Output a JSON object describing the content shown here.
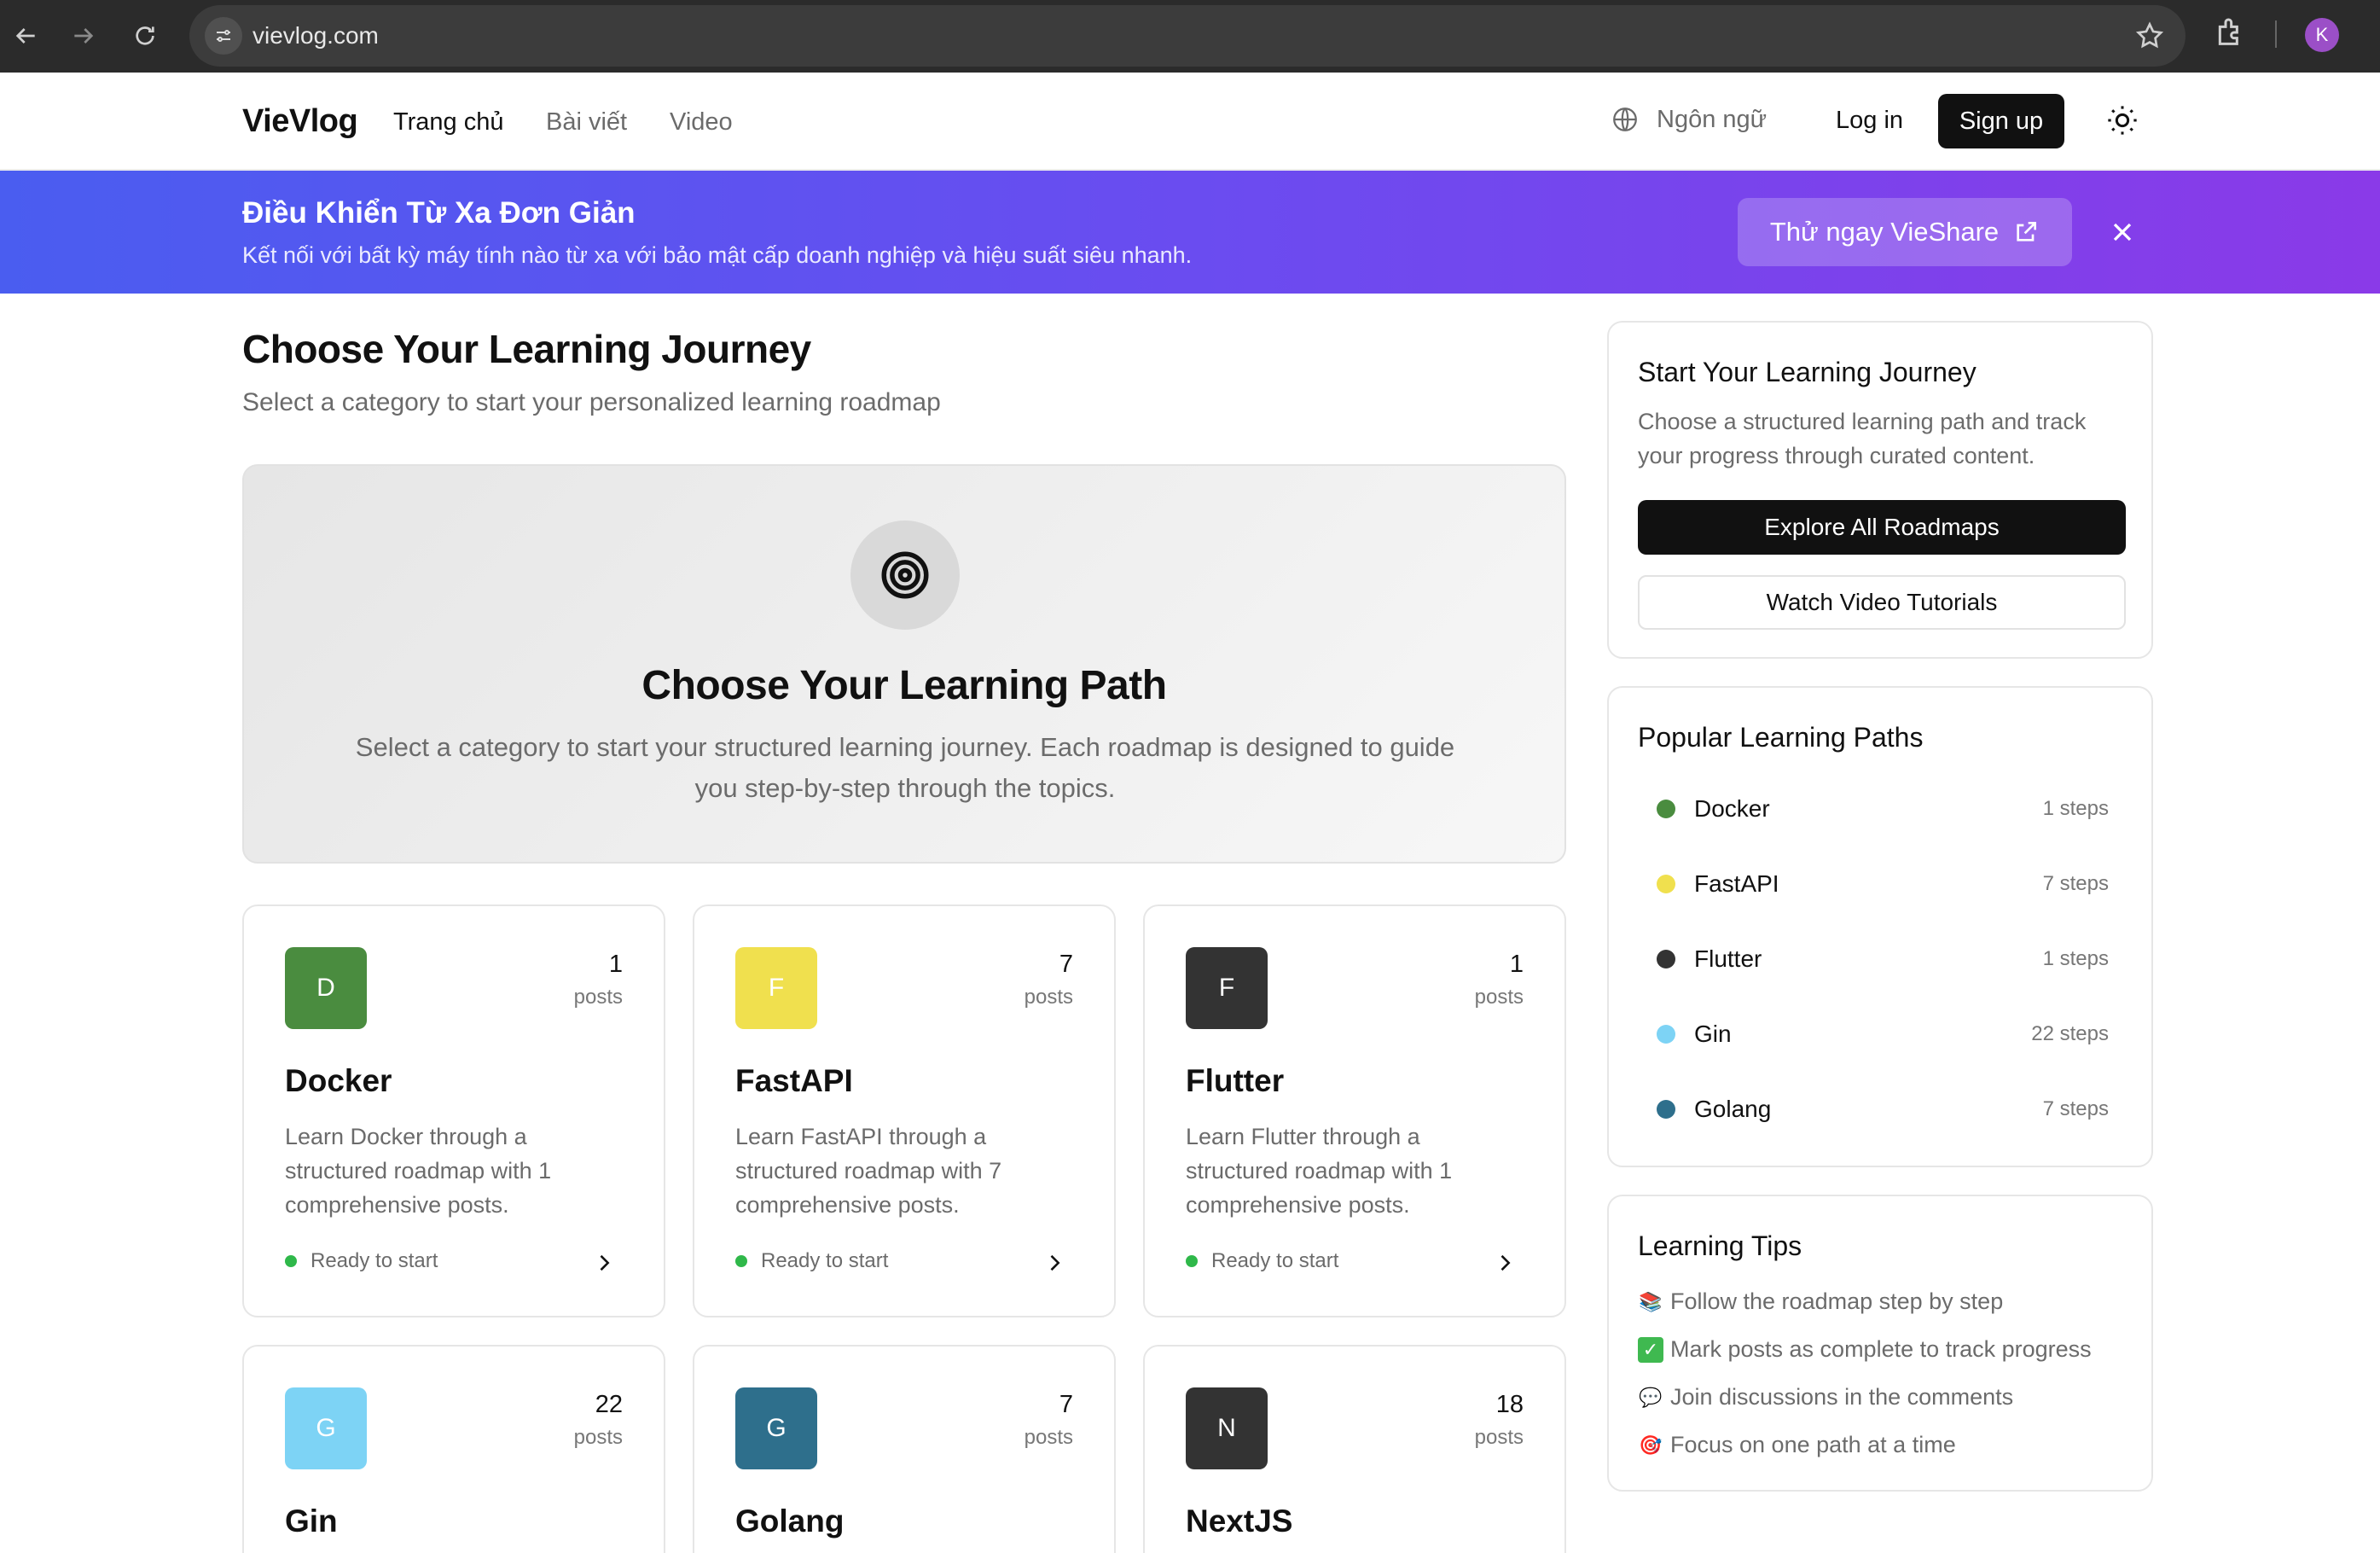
{
  "browser": {
    "url": "vievlog.com",
    "profile_initial": "K"
  },
  "header": {
    "logo": "VieVlog",
    "nav": [
      "Trang chủ",
      "Bài viết",
      "Video"
    ],
    "language_label": "Ngôn ngữ",
    "login_label": "Log in",
    "signup_label": "Sign up"
  },
  "banner": {
    "title": "Điều Khiển Từ Xa Đơn Giản",
    "subtitle": "Kết nối với bất kỳ máy tính nào từ xa với bảo mật cấp doanh nghiệp và hiệu suất siêu nhanh.",
    "cta_label": "Thử ngay VieShare"
  },
  "main": {
    "title": "Choose Your Learning Journey",
    "subtitle": "Select a category to start your personalized learning roadmap",
    "hero": {
      "title": "Choose Your Learning Path",
      "description": "Select a category to start your structured learning journey. Each roadmap is designed to guide you step-by-step through the topics."
    },
    "cards": [
      {
        "initial": "D",
        "color": "#4a8c3f",
        "count": "1",
        "count_label": "posts",
        "name": "Docker",
        "description": "Learn Docker through a structured roadmap with 1 comprehensive posts.",
        "status": "Ready to start"
      },
      {
        "initial": "F",
        "color": "#f0e04e",
        "count": "7",
        "count_label": "posts",
        "name": "FastAPI",
        "description": "Learn FastAPI through a structured roadmap with 7 comprehensive posts.",
        "status": "Ready to start"
      },
      {
        "initial": "F",
        "color": "#333333",
        "count": "1",
        "count_label": "posts",
        "name": "Flutter",
        "description": "Learn Flutter through a structured roadmap with 1 comprehensive posts.",
        "status": "Ready to start"
      },
      {
        "initial": "G",
        "color": "#7dd3f5",
        "count": "22",
        "count_label": "posts",
        "name": "Gin"
      },
      {
        "initial": "G",
        "color": "#2e6f8c",
        "count": "7",
        "count_label": "posts",
        "name": "Golang"
      },
      {
        "initial": "N",
        "color": "#333333",
        "count": "18",
        "count_label": "posts",
        "name": "NextJS"
      }
    ]
  },
  "sidebar": {
    "journey": {
      "title": "Start Your Learning Journey",
      "text": "Choose a structured learning path and track your progress through curated content.",
      "primary_button": "Explore All Roadmaps",
      "secondary_button": "Watch Video Tutorials"
    },
    "popular": {
      "title": "Popular Learning Paths",
      "items": [
        {
          "name": "Docker",
          "steps": "1 steps",
          "color": "#4a8c3f"
        },
        {
          "name": "FastAPI",
          "steps": "7 steps",
          "color": "#f0e04e"
        },
        {
          "name": "Flutter",
          "steps": "1 steps",
          "color": "#333333"
        },
        {
          "name": "Gin",
          "steps": "22 steps",
          "color": "#7dd3f5"
        },
        {
          "name": "Golang",
          "steps": "7 steps",
          "color": "#2e6f8c"
        }
      ]
    },
    "tips": {
      "title": "Learning Tips",
      "items": [
        {
          "icon": "books-icon",
          "text": "Follow the roadmap step by step"
        },
        {
          "icon": "checkmark-icon",
          "text": "Mark posts as complete to track progress"
        },
        {
          "icon": "speech-bubble-icon",
          "text": "Join discussions in the comments"
        },
        {
          "icon": "target-icon",
          "text": "Focus on one path at a time"
        }
      ]
    }
  }
}
